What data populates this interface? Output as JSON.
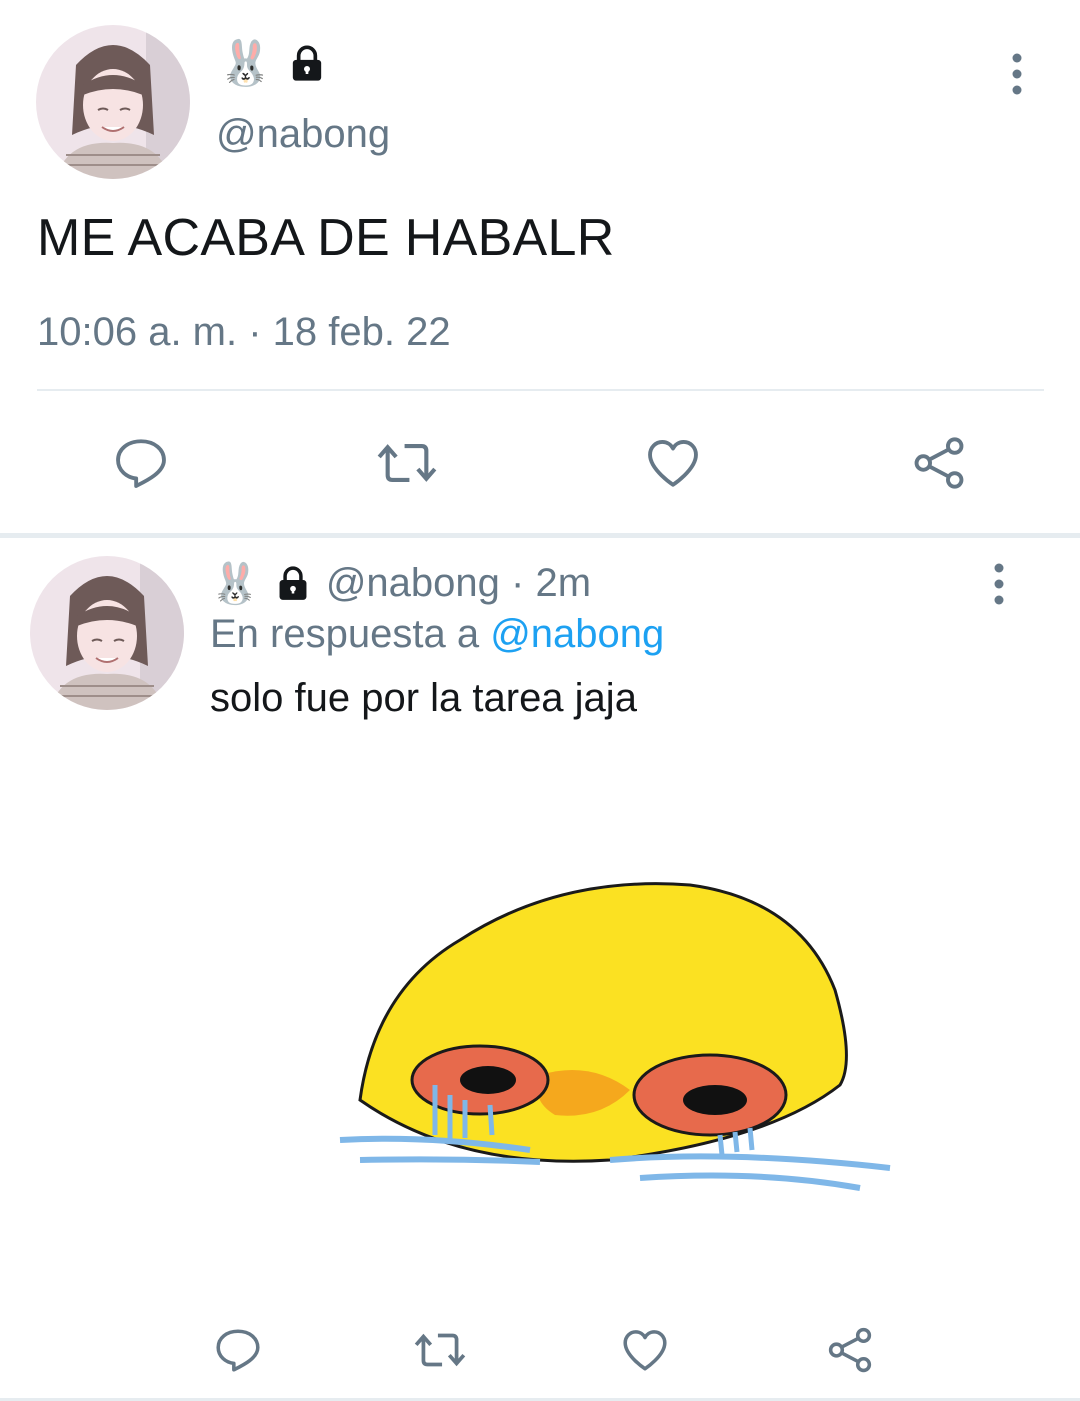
{
  "main_tweet": {
    "display_emoji": "🐰",
    "handle": "@nabong",
    "text": "ME ACABA DE HABALR",
    "timestamp": "10:06 a. m. · 18 feb. 22",
    "icons": [
      "lock-icon",
      "more-vertical-icon",
      "reply-icon",
      "retweet-icon",
      "like-icon",
      "share-icon"
    ]
  },
  "reply_tweet": {
    "display_emoji": "🐰",
    "handle": "@nabong",
    "time_sep": " · ",
    "time": "2m",
    "reply_prefix": "En respuesta a ",
    "reply_handle": "@nabong",
    "text": "solo fue por la tarea jaja",
    "icons": [
      "lock-icon",
      "more-vertical-icon",
      "reply-icon",
      "retweet-icon",
      "like-icon",
      "share-icon"
    ]
  },
  "colors": {
    "secondary_text": "#657786",
    "link": "#1da1f2",
    "divider": "#e6ecf0",
    "emoji_yellow": "#fbe122",
    "tear_blue": "#7fb7e8"
  }
}
